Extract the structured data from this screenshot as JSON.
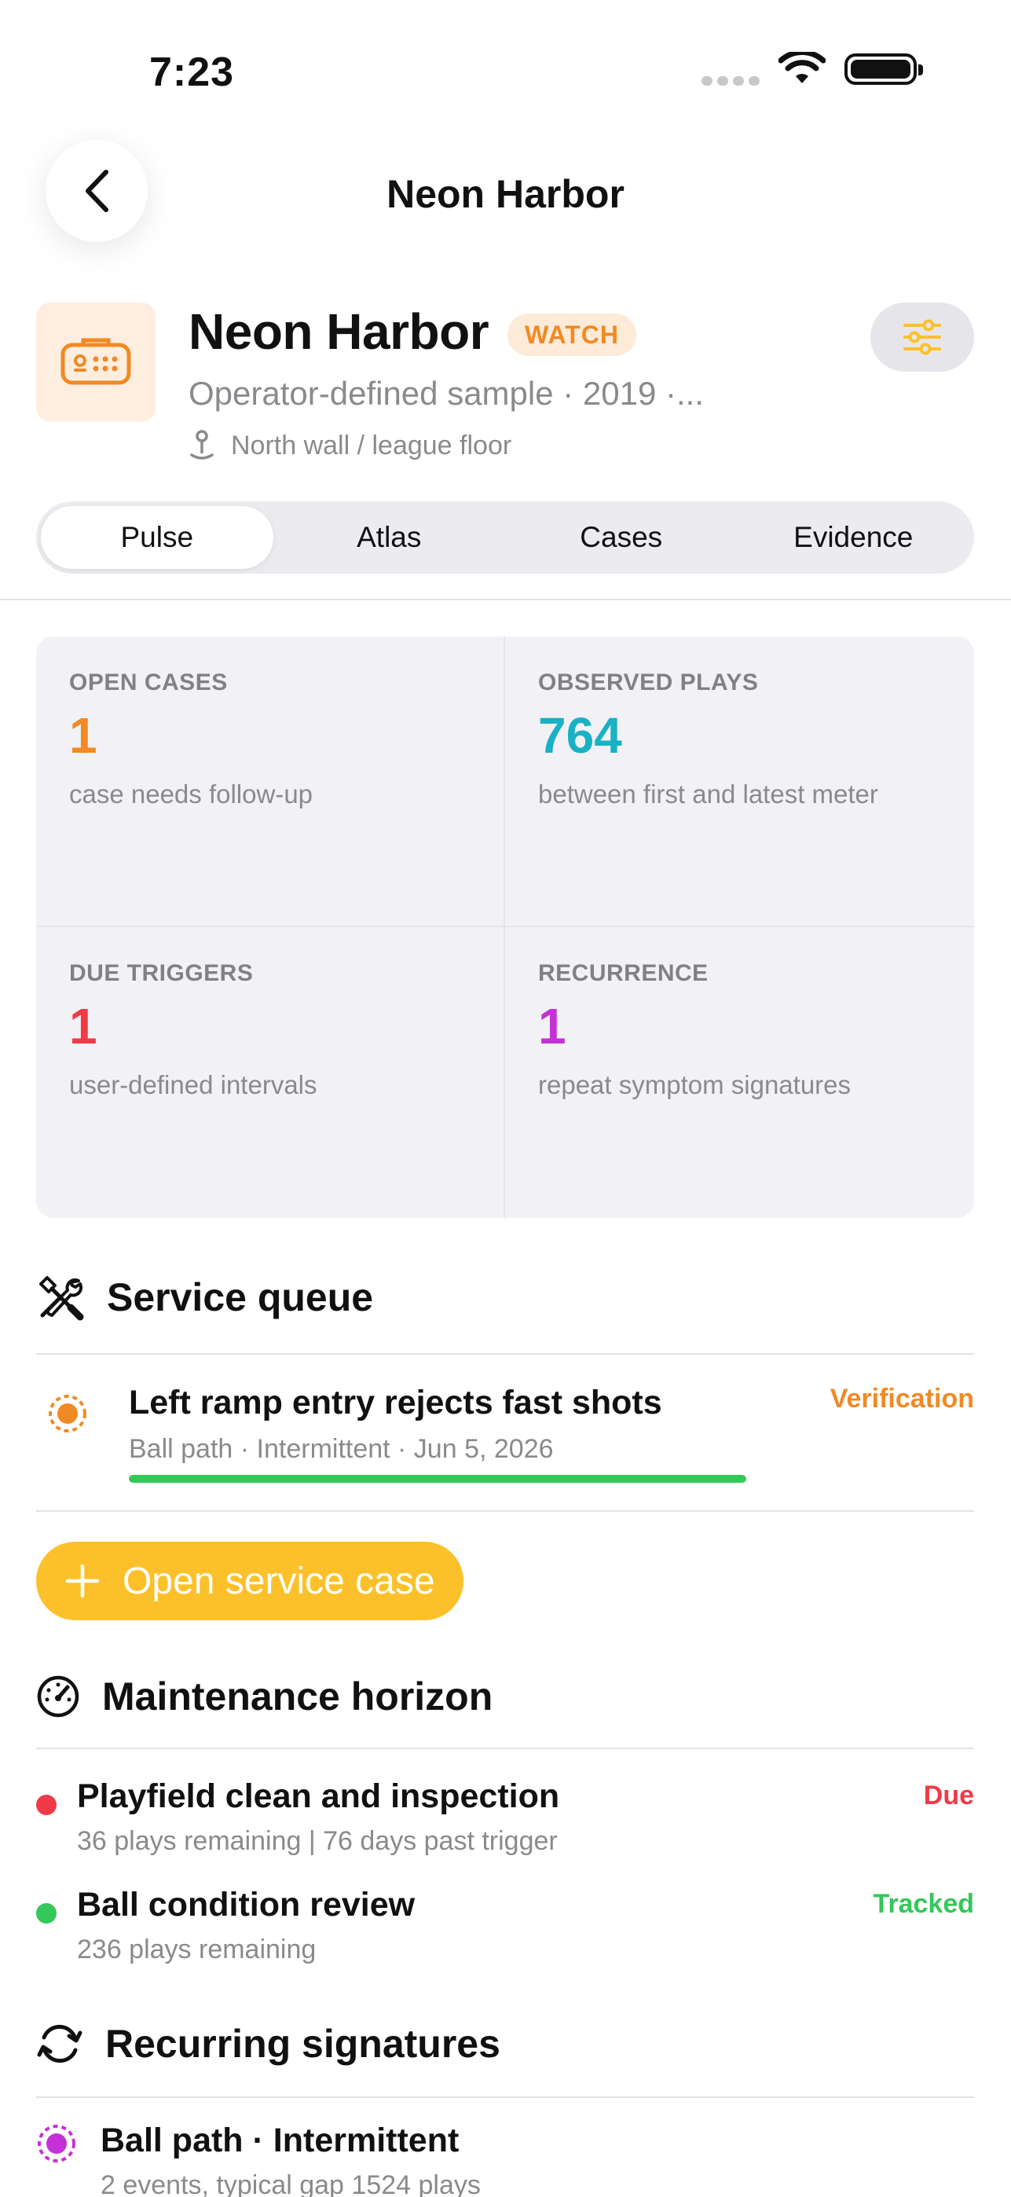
{
  "status_bar": {
    "time": "7:23"
  },
  "nav": {
    "title": "Neon Harbor"
  },
  "machine": {
    "name": "Neon Harbor",
    "badge": "WATCH",
    "subtitle": "Operator-defined sample  ·  2019  ·...",
    "location": "North wall / league floor"
  },
  "tabs": [
    {
      "label": "Pulse",
      "active": true
    },
    {
      "label": "Atlas",
      "active": false
    },
    {
      "label": "Cases",
      "active": false
    },
    {
      "label": "Evidence",
      "active": false
    }
  ],
  "stats": [
    {
      "label": "OPEN CASES",
      "value": "1",
      "caption": "case needs follow-up",
      "color": "#f08a24"
    },
    {
      "label": "OBSERVED PLAYS",
      "value": "764",
      "caption": "between first and latest meter",
      "color": "#1ab1c4"
    },
    {
      "label": "DUE TRIGGERS",
      "value": "1",
      "caption": "user-defined intervals",
      "color": "#f03a47"
    },
    {
      "label": "RECURRENCE",
      "value": "1",
      "caption": "repeat symptom signatures",
      "color": "#c531d6"
    }
  ],
  "service_queue": {
    "title": "Service queue",
    "cases": [
      {
        "title": "Left ramp entry rejects fast shots",
        "meta": "Ball path · Intermittent · Jun 5, 2026",
        "status": "Verification",
        "progress": 1.0
      }
    ],
    "open_button_label": "Open service case"
  },
  "maintenance": {
    "title": "Maintenance horizon",
    "items": [
      {
        "title": "Playfield clean and inspection",
        "meta": "36 plays remaining | 76 days past trigger",
        "status": "Due",
        "color": "#f03a47"
      },
      {
        "title": "Ball condition review",
        "meta": "236 plays remaining",
        "status": "Tracked",
        "color": "#34c759"
      }
    ]
  },
  "recurring": {
    "title": "Recurring signatures",
    "items": [
      {
        "title": "Ball path · Intermittent",
        "meta": "2 events, typical gap 1524 plays",
        "color": "#c531d6"
      }
    ]
  },
  "colors": {
    "accent_orange": "#f08a24",
    "accent_yellow": "#fcc12a",
    "green": "#34c759",
    "red": "#f03a47",
    "purple": "#c531d6",
    "teal": "#1ab1c4"
  }
}
